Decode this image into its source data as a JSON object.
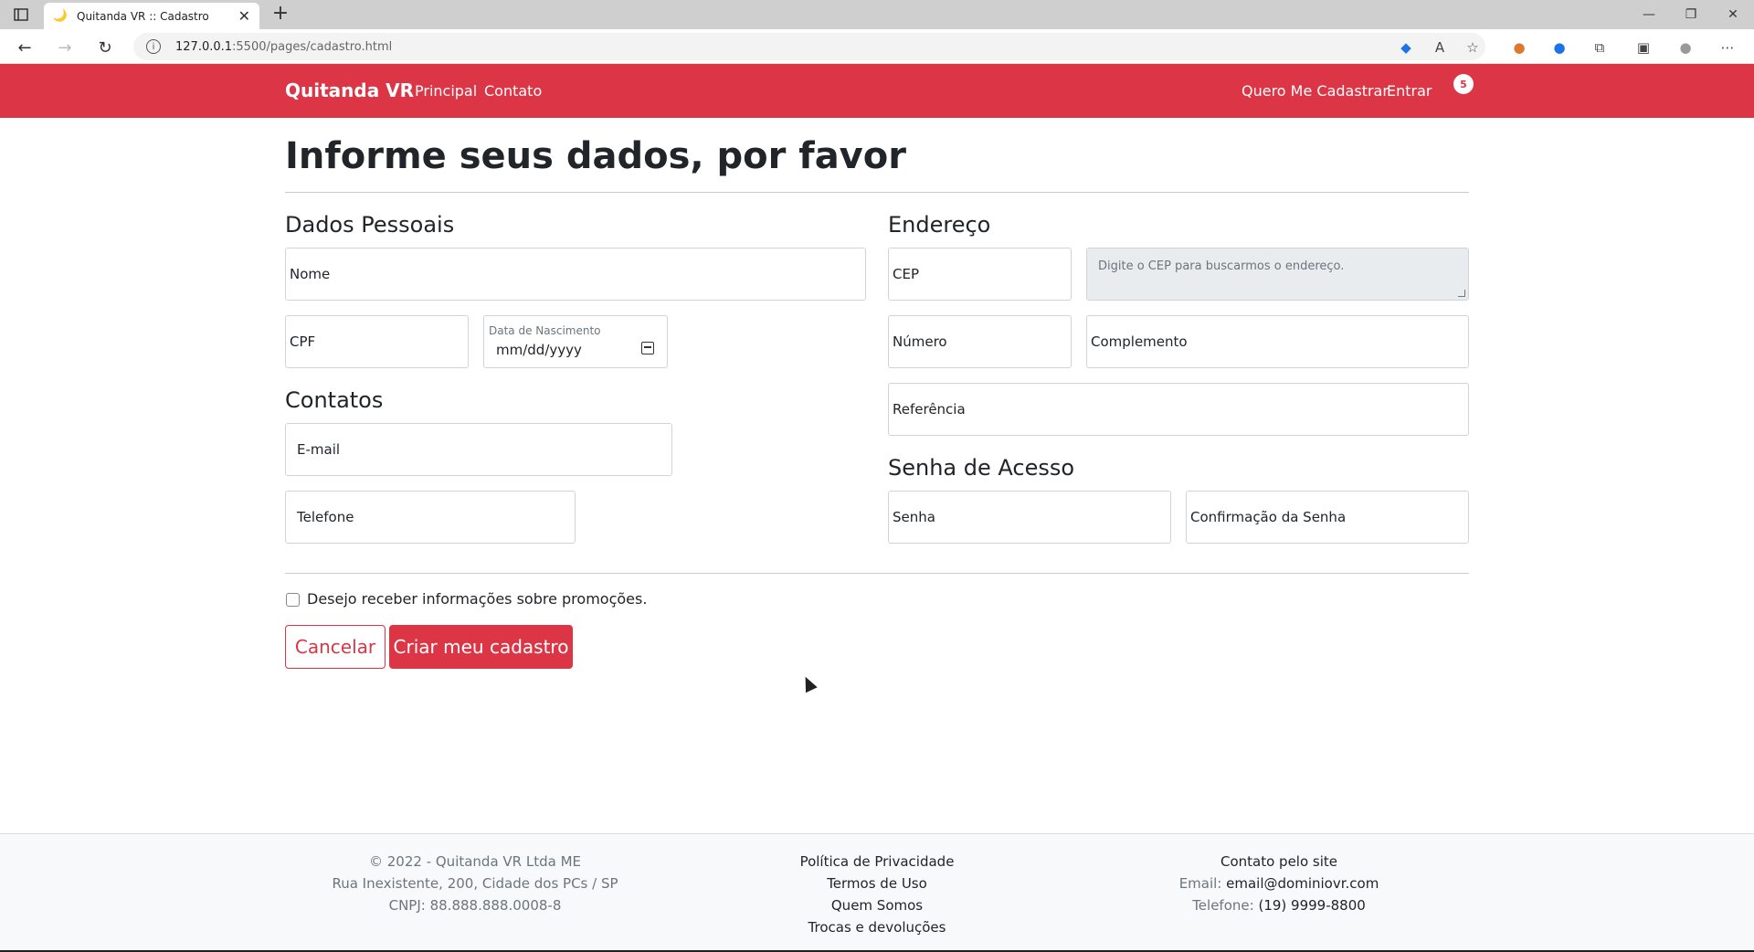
{
  "browser": {
    "tab_title": "Quitanda VR :: Cadastro",
    "tab_favicon": "🌙",
    "url_host": "127.0.0.1",
    "url_path": ":5500/pages/cadastro.html"
  },
  "navbar": {
    "brand": "Quitanda VR",
    "links": [
      "Principal",
      "Contato"
    ],
    "right_links": [
      "Quero Me Cadastrar",
      "Entrar"
    ],
    "cart_count": "5",
    "bg_color": "#dc3545"
  },
  "page": {
    "title": "Informe seus dados, por favor"
  },
  "sections": {
    "personal": "Dados Pessoais",
    "contacts": "Contatos",
    "address": "Endereço",
    "password": "Senha de Acesso"
  },
  "fields": {
    "nome": "Nome",
    "cpf": "CPF",
    "birth_label": "Data de Nascimento",
    "birth_value": "mm/dd/yyyy",
    "email": "E-mail",
    "telefone": "Telefone",
    "cep": "CEP",
    "endereco_placeholder": "Digite o CEP para buscarmos o endereço.",
    "numero": "Número",
    "complemento": "Complemento",
    "referencia": "Referência",
    "senha": "Senha",
    "confirmacao": "Confirmação da Senha"
  },
  "promo_checkbox": "Desejo receber informações sobre promoções.",
  "buttons": {
    "cancel": "Cancelar",
    "submit": "Criar meu cadastro"
  },
  "footer": {
    "col1": [
      "© 2022 - Quitanda VR Ltda ME",
      "Rua Inexistente, 200, Cidade dos PCs / SP",
      "CNPJ: 88.888.888.0008-8"
    ],
    "col2": [
      "Política de Privacidade",
      "Termos de Uso",
      "Quem Somos",
      "Trocas e devoluções"
    ],
    "col3_title": "Contato pelo site",
    "email_label": "Email:",
    "email_value": "email@dominiovr.com",
    "phone_label": "Telefone:",
    "phone_value": "(19) 9999-8800"
  }
}
